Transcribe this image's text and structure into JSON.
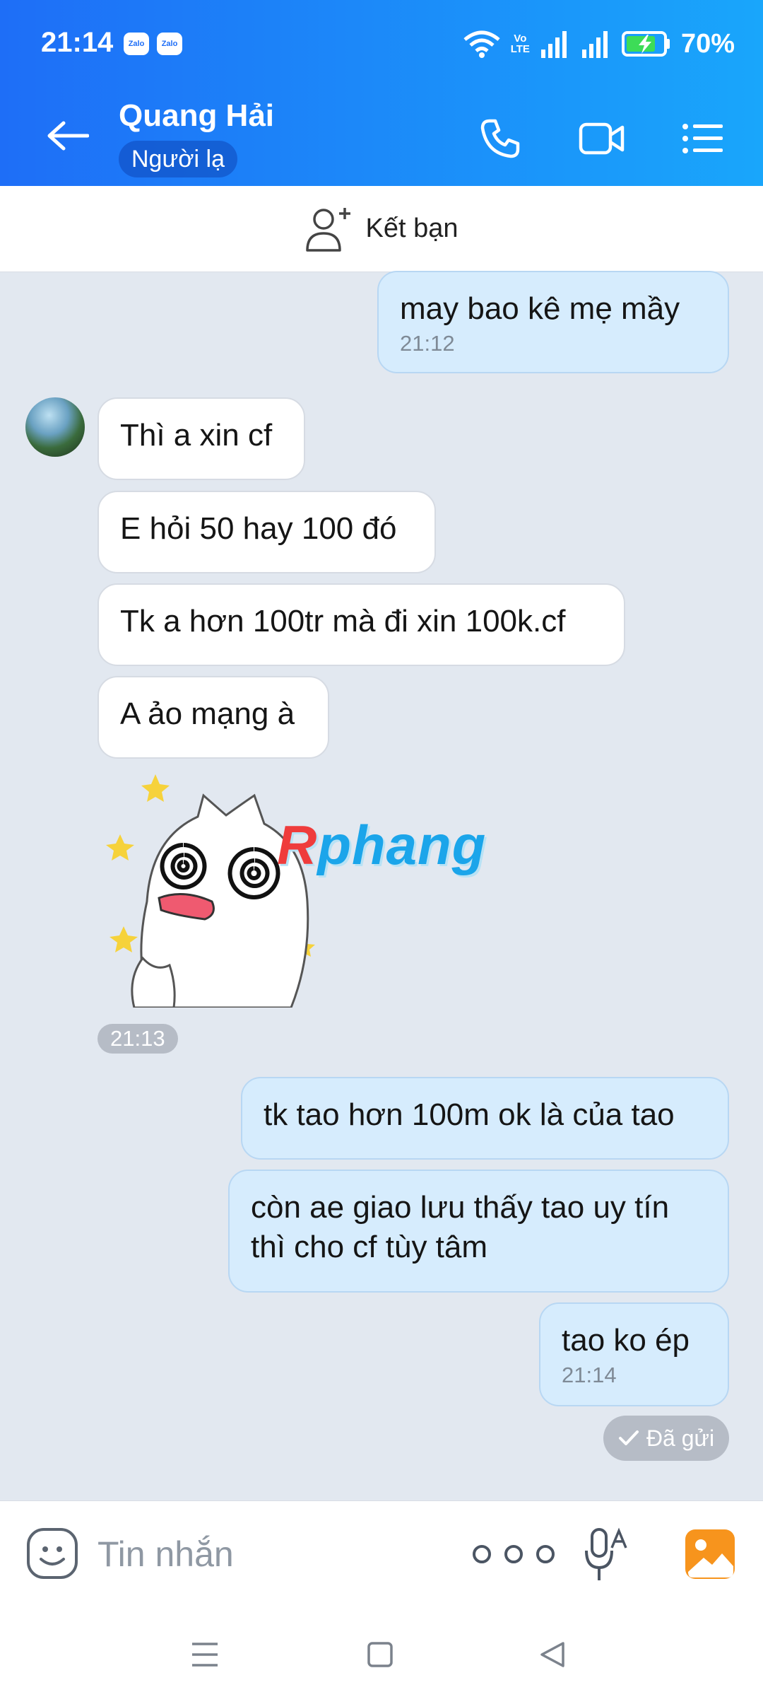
{
  "status_bar": {
    "time": "21:14",
    "notif_icons": [
      "Zalo",
      "Zalo"
    ],
    "volte": [
      "Vo",
      "LTE"
    ],
    "battery_percent": "70%"
  },
  "header": {
    "contact_name": "Quang Hải",
    "badge": "Người lạ",
    "icons": [
      "back-arrow-icon",
      "phone-icon",
      "video-call-icon",
      "menu-list-icon"
    ],
    "colors": {
      "gradient_start": "#1e6ef7",
      "gradient_end": "#19a6fb"
    }
  },
  "add_friend": {
    "label": "Kết bạn"
  },
  "messages": [
    {
      "dir": "out",
      "text": "may bao kê mẹ mầy",
      "time": "21:12"
    },
    {
      "dir": "in",
      "text": "Thì a xin cf"
    },
    {
      "dir": "in",
      "text": "E hỏi 50 hay 100 đó"
    },
    {
      "dir": "in",
      "text": "Tk a hơn 100tr mà đi xin 100k.cf"
    },
    {
      "dir": "in",
      "text": "A ảo mạng à"
    },
    {
      "dir": "in",
      "type": "sticker",
      "time": "21:13"
    },
    {
      "dir": "out",
      "text": "tk tao hơn 100m ok là của tao"
    },
    {
      "dir": "out",
      "text": "còn ae giao lưu thấy tao uy tín thì cho cf tùy tâm"
    },
    {
      "dir": "out",
      "text": "tao ko ép",
      "time": "21:14"
    }
  ],
  "watermark": {
    "first": "R",
    "rest": "phang"
  },
  "sent_status": "Đã gửi",
  "input": {
    "placeholder": "Tin nhắn"
  }
}
